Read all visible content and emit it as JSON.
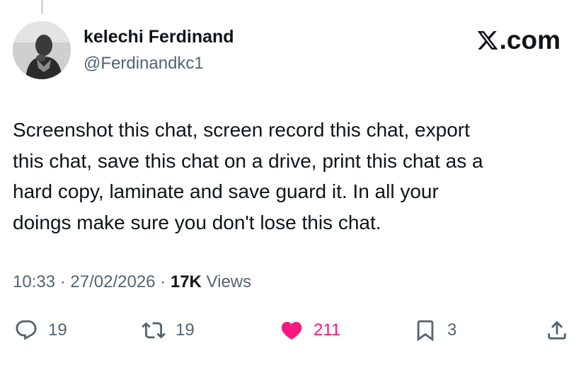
{
  "author": {
    "display_name": "kelechi Ferdinand",
    "handle": "@Ferdinandkc1",
    "avatar_icon": "profile-photo"
  },
  "brand": {
    "text": ".com",
    "icon": "x-logo-icon"
  },
  "tweet": {
    "text": "Screenshot this chat, screen record this chat, export\nthis chat, save this chat on a drive, print this chat as a\nhard copy, laminate and save guard it. In all your\ndoings make sure you don't lose this chat."
  },
  "meta": {
    "time": "10:33",
    "separator": " · ",
    "date": "27/02/2026",
    "views_count": "17K",
    "views_label": " Views"
  },
  "actions": {
    "reply": {
      "icon": "reply-bubble-icon",
      "count": "19"
    },
    "repost": {
      "icon": "repost-icon",
      "count": "19"
    },
    "like": {
      "icon": "heart-icon",
      "count": "211",
      "liked": true,
      "color": "#f91880"
    },
    "bookmark": {
      "icon": "bookmark-icon",
      "count": "3"
    },
    "share": {
      "icon": "share-icon"
    }
  },
  "colors": {
    "text_primary": "#0f1419",
    "text_secondary": "#536471",
    "like_active": "#f91880",
    "thread_line": "#cfd9de"
  }
}
